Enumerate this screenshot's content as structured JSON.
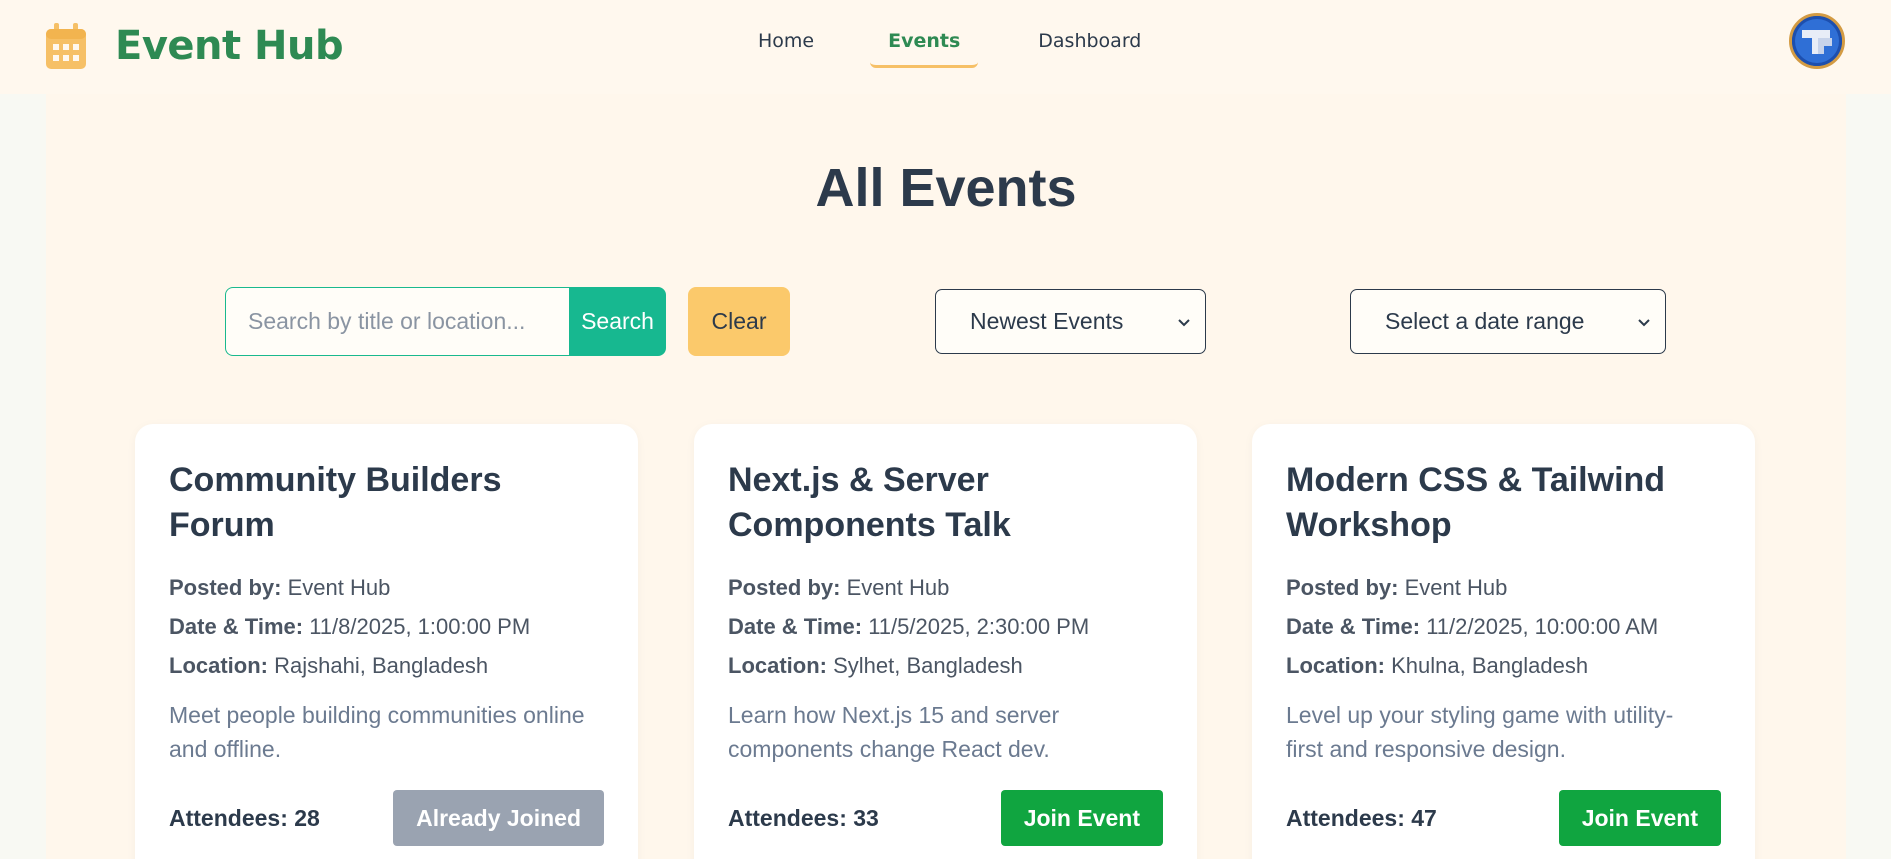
{
  "brand": {
    "name": "Event Hub",
    "icon": "calendar-icon",
    "icon_color": "#f6c066",
    "text_color": "#2e8a53"
  },
  "nav": {
    "items": [
      {
        "label": "Home",
        "active": false
      },
      {
        "label": "Events",
        "active": true
      },
      {
        "label": "Dashboard",
        "active": false
      }
    ]
  },
  "user": {
    "avatar": "user-avatar"
  },
  "page": {
    "title": "All Events"
  },
  "filters": {
    "search_placeholder": "Search by title or location...",
    "search_value": "",
    "search_button": "Search",
    "clear_button": "Clear",
    "sort_selected": "Newest Events",
    "date_selected": "Select a date range"
  },
  "events": [
    {
      "title": "Community Builders Forum",
      "posted_by_label": "Posted by:",
      "posted_by": "Event Hub",
      "datetime_label": "Date & Time:",
      "datetime": "11/8/2025, 1:00:00 PM",
      "location_label": "Location:",
      "location": "Rajshahi, Bangladesh",
      "description": "Meet people building communities online and offline.",
      "attendees": "Attendees: 28",
      "action": "Already Joined"
    },
    {
      "title": "Next.js & Server Components Talk",
      "posted_by_label": "Posted by:",
      "posted_by": "Event Hub",
      "datetime_label": "Date & Time:",
      "datetime": "11/5/2025, 2:30:00 PM",
      "location_label": "Location:",
      "location": "Sylhet, Bangladesh",
      "description": "Learn how Next.js 15 and server components change React dev.",
      "attendees": "Attendees: 33",
      "action": "Join Event"
    },
    {
      "title": "Modern CSS & Tailwind Workshop",
      "posted_by_label": "Posted by:",
      "posted_by": "Event Hub",
      "datetime_label": "Date & Time:",
      "datetime": "11/2/2025, 10:00:00 AM",
      "location_label": "Location:",
      "location": "Khulna, Bangladesh",
      "description": "Level up your styling game with utility-first and responsive design.",
      "attendees": "Attendees: 47",
      "action": "Join Event"
    }
  ],
  "colors": {
    "accent": "#17b890",
    "join": "#10a540",
    "joined": "#9aa3b1",
    "clear": "#fbc96b",
    "heading": "#2c3a4b"
  }
}
